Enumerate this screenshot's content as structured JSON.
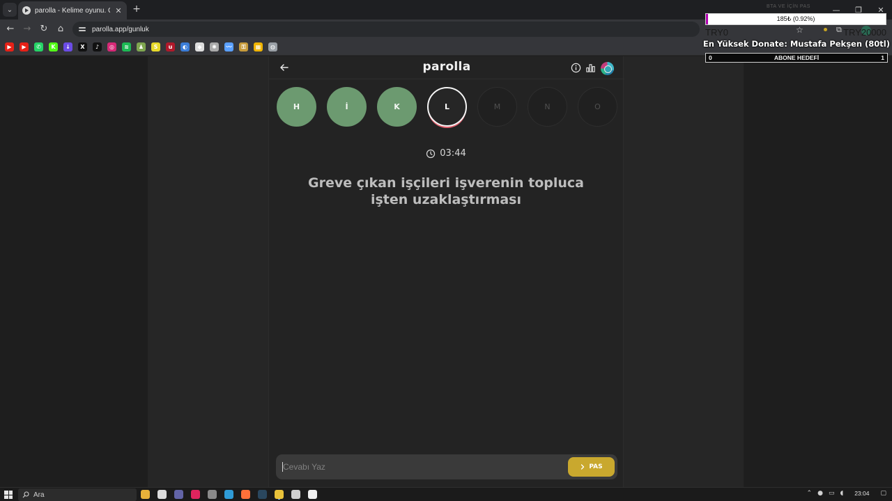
{
  "browser": {
    "tab_title": "parolla - Kelime oyunu. Günlük",
    "tab_close": "✕",
    "new_tab": "+",
    "url": "parolla.app/gunluk",
    "window_controls": [
      "—",
      "❐",
      "✕"
    ]
  },
  "bookmarks": [
    {
      "icon": "youtube-icon",
      "color": "#e62117",
      "glyph": "▶"
    },
    {
      "icon": "youtube-icon",
      "color": "#e62117",
      "glyph": "▶"
    },
    {
      "icon": "whatsapp-icon",
      "color": "#25d366",
      "glyph": "✆"
    },
    {
      "icon": "kick-icon",
      "color": "#53fc18",
      "glyph": "K"
    },
    {
      "icon": "download-icon",
      "color": "#6b4ce6",
      "glyph": "↓"
    },
    {
      "icon": "x-icon",
      "color": "#111111",
      "glyph": "X"
    },
    {
      "icon": "tiktok-icon",
      "color": "#111111",
      "glyph": "♪"
    },
    {
      "icon": "instagram-icon",
      "color": "#d62976",
      "glyph": "◎"
    },
    {
      "icon": "spotify-icon",
      "color": "#1db954",
      "glyph": "≋"
    },
    {
      "icon": "chess-icon",
      "color": "#7fa650",
      "glyph": "♟"
    },
    {
      "icon": "streamlabs-icon",
      "color": "#e7d92a",
      "glyph": "S"
    },
    {
      "icon": "ublock-icon",
      "color": "#b0192b",
      "glyph": "u"
    },
    {
      "icon": "globe-icon",
      "color": "#3b7dd8",
      "glyph": "◐"
    },
    {
      "icon": "diamond-icon",
      "color": "#dddddd",
      "glyph": "◆"
    },
    {
      "icon": "settings-icon",
      "color": "#aaaaaa",
      "glyph": "✺"
    },
    {
      "icon": "chart-icon",
      "color": "#5aa0ff",
      "glyph": "〰"
    },
    {
      "icon": "key-icon",
      "color": "#c79b3b",
      "glyph": "⚿"
    },
    {
      "icon": "grid-icon",
      "color": "#f0b400",
      "glyph": "▦"
    },
    {
      "icon": "world-icon",
      "color": "#9aa0a6",
      "glyph": "◍"
    }
  ],
  "overlay": {
    "faint_header": "BTA VE İÇİN PAS",
    "goal_text": "185₺ (0.92%)",
    "goal_fraction": 0.0092,
    "goal_min": "TRY0",
    "goal_max": "TRY20000",
    "donate_text": "En Yüksek Donate: Mustafa Pekşen (80tl)",
    "sub_min": "0",
    "sub_label": "ABONE HEDEFİ",
    "sub_max": "1"
  },
  "app": {
    "brand": "parolla",
    "letters": [
      {
        "char": "H",
        "state": "done"
      },
      {
        "char": "İ",
        "state": "done"
      },
      {
        "char": "K",
        "state": "done"
      },
      {
        "char": "L",
        "state": "current"
      },
      {
        "char": "M",
        "state": "pending"
      },
      {
        "char": "N",
        "state": "pending"
      },
      {
        "char": "O",
        "state": "pending"
      }
    ],
    "timer": "03:44",
    "question_line1": "Greve çıkan işçileri işverenin topluca",
    "question_line2": "işten uzaklaştırması",
    "answer_placeholder": "Cevabı Yaz",
    "pass_label": "PAS"
  },
  "taskbar": {
    "search_label": "Ara",
    "time": "23:04",
    "apps": [
      {
        "name": "file-explorer-icon",
        "color": "#e8b23a"
      },
      {
        "name": "store-icon",
        "color": "#dcdcdc"
      },
      {
        "name": "teams-icon",
        "color": "#6264a7"
      },
      {
        "name": "app-red-icon",
        "color": "#e0245e"
      },
      {
        "name": "terminal-icon",
        "color": "#8a8a8a"
      },
      {
        "name": "edge-icon",
        "color": "#2f9bd6"
      },
      {
        "name": "firefox-icon",
        "color": "#ff7139"
      },
      {
        "name": "steam-icon",
        "color": "#2a475e"
      },
      {
        "name": "chrome-icon",
        "color": "#e9c23a"
      },
      {
        "name": "obs-icon",
        "color": "#cfcfcf"
      },
      {
        "name": "capcut-icon",
        "color": "#f0f0f0"
      }
    ]
  },
  "colors": {
    "done_letter": "#6c9a70",
    "pass_button": "#c9a82e",
    "current_ring_accent": "#e05f6d",
    "goal_fill": "#b000b0"
  }
}
